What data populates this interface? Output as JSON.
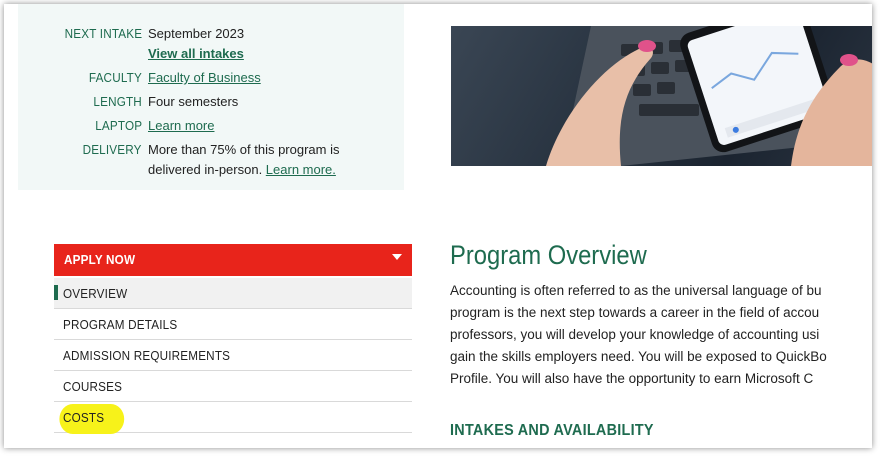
{
  "info": {
    "rows": [
      {
        "label": "NEXT INTAKE",
        "value": "September 2023",
        "link": "View all intakes"
      },
      {
        "label": "FACULTY",
        "link": "Faculty of Business"
      },
      {
        "label": "LENGTH",
        "value": "Four semesters"
      },
      {
        "label": "LAPTOP",
        "link": "Learn more"
      },
      {
        "label": "DELIVERY",
        "value_line1": "More than 75% of this program is",
        "value_line2_prefix": "delivered in-person. ",
        "link": "Learn more."
      }
    ]
  },
  "image": {
    "alt": "hands holding smartphone near laptop keyboard"
  },
  "nav": {
    "apply_label": "APPLY NOW",
    "items": [
      "OVERVIEW",
      "PROGRAM DETAILS",
      "ADMISSION REQUIREMENTS",
      "COURSES",
      "COSTS"
    ]
  },
  "overview": {
    "title": "Program Overview",
    "lines": [
      "Accounting is often referred to as the universal language of bu",
      "program is the next step towards a career in the field of accou",
      "professors, you will develop your knowledge of accounting usi",
      "gain the skills employers need. You will be exposed to QuickBo",
      "Profile. You will also have the opportunity to earn Microsoft C"
    ]
  },
  "intakes_heading": "INTAKES AND AVAILABILITY",
  "colors": {
    "brand_green": "#1e6b4f",
    "apply_red": "#e8241b",
    "highlight_yellow": "#f7f21a"
  }
}
